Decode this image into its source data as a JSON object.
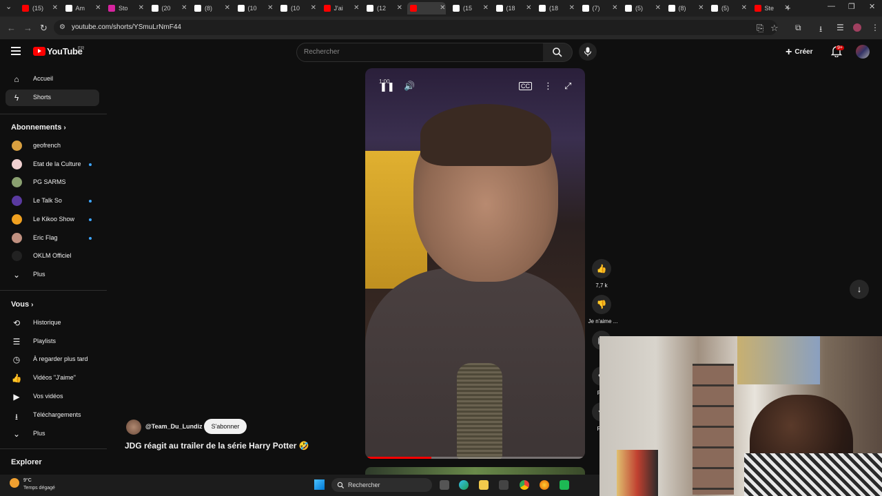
{
  "browser": {
    "tabs": [
      {
        "label": "(15)",
        "icon": "youtube-icon",
        "color": "#ff0000"
      },
      {
        "label": "Am",
        "icon": "wikipedia-icon",
        "color": "#ffffff"
      },
      {
        "label": "Sto",
        "icon": "instagram-icon",
        "color": "#d6249f"
      },
      {
        "label": "(20",
        "icon": "x-icon",
        "color": "#ffffff"
      },
      {
        "label": "(8)",
        "icon": "x-icon",
        "color": "#ffffff"
      },
      {
        "label": "(10",
        "icon": "x-icon",
        "color": "#ffffff"
      },
      {
        "label": "(10",
        "icon": "x-icon",
        "color": "#ffffff"
      },
      {
        "label": "J'ai",
        "icon": "youtube-icon",
        "color": "#ff0000"
      },
      {
        "label": "(12",
        "icon": "x-icon",
        "color": "#ffffff"
      },
      {
        "label": "",
        "icon": "youtube-icon",
        "color": "#ff0000",
        "active": true
      },
      {
        "label": "(15",
        "icon": "x-icon",
        "color": "#ffffff"
      },
      {
        "label": "(18",
        "icon": "x-icon",
        "color": "#ffffff"
      },
      {
        "label": "(18",
        "icon": "x-icon",
        "color": "#ffffff"
      },
      {
        "label": "(7)",
        "icon": "x-icon",
        "color": "#ffffff"
      },
      {
        "label": "(5)",
        "icon": "x-icon",
        "color": "#ffffff"
      },
      {
        "label": "(8)",
        "icon": "x-icon",
        "color": "#ffffff"
      },
      {
        "label": "(5)",
        "icon": "x-icon",
        "color": "#ffffff"
      },
      {
        "label": "Ste",
        "icon": "youtube-icon",
        "color": "#ff0000"
      }
    ],
    "url": "youtube.com/shorts/YSmuLrNmF44"
  },
  "youtube": {
    "logo_text": "YouTube",
    "region": "FR",
    "search_placeholder": "Rechercher",
    "create_label": "Créer",
    "notif_badge": "9+",
    "accent": "#ff0000"
  },
  "sidebar": {
    "main": [
      {
        "label": "Accueil",
        "icon": "home-icon"
      },
      {
        "label": "Shorts",
        "icon": "shorts-icon",
        "selected": true
      }
    ],
    "subs_title": "Abonnements",
    "subs": [
      {
        "label": "geofrench",
        "color": "#d9a040",
        "dot": false
      },
      {
        "label": "Etat de la Culture",
        "color": "#f0d0d0",
        "dot": true
      },
      {
        "label": "PG SARMS",
        "color": "#8aa070",
        "dot": false
      },
      {
        "label": "Le Talk So",
        "color": "#5a3aa0",
        "dot": true
      },
      {
        "label": "Le Kikoo Show",
        "color": "#f0a020",
        "dot": true
      },
      {
        "label": "Eric Flag",
        "color": "#c09080",
        "dot": true
      },
      {
        "label": "OKLM Officiel",
        "color": "#222222",
        "dot": false
      }
    ],
    "subs_more": "Plus",
    "you_title": "Vous",
    "you": [
      {
        "label": "Historique",
        "icon": "history-icon"
      },
      {
        "label": "Playlists",
        "icon": "playlist-icon"
      },
      {
        "label": "À regarder plus tard",
        "icon": "clock-icon"
      },
      {
        "label": "Vidéos \"J'aime\"",
        "icon": "thumb-up-icon"
      },
      {
        "label": "Vos vidéos",
        "icon": "video-icon"
      },
      {
        "label": "Téléchargements",
        "icon": "download-icon"
      }
    ],
    "you_more": "Plus",
    "explore_title": "Explorer"
  },
  "short": {
    "time": "1:00",
    "progress": 0.3,
    "likes": "7,7 k",
    "dislike_label": "Je n'aime ...",
    "share_partial": "Par",
    "remix_partial": "Rer",
    "channel": "@Team_Du_Lundiz",
    "subscribe_label": "S'abonner",
    "title": "JDG réagit au trailer de la série Harry Potter 🤣"
  },
  "taskbar": {
    "temp": "9°C",
    "weather": "Temps dégagé",
    "search_label": "Rechercher"
  }
}
